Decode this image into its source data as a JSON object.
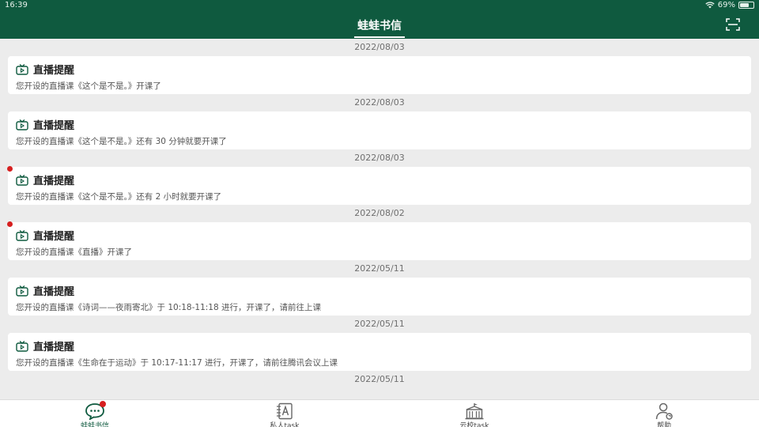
{
  "status_bar": {
    "time": "16:39",
    "battery": "69%",
    "battery_level": 0.69
  },
  "header": {
    "title": "蛙蛙书信",
    "scan_icon": "scan-icon"
  },
  "colors": {
    "primary": "#0f5a3f",
    "badge": "#d61f1f",
    "background": "#ececec"
  },
  "messages": [
    {
      "date": "2022/08/03",
      "title": "直播提醒",
      "body": "您开设的直播课《这个是不是。》开课了",
      "unread": false
    },
    {
      "date": "2022/08/03",
      "title": "直播提醒",
      "body": "您开设的直播课《这个是不是。》还有 30 分钟就要开课了",
      "unread": false
    },
    {
      "date": "2022/08/03",
      "title": "直播提醒",
      "body": "您开设的直播课《这个是不是。》还有 2 小时就要开课了",
      "unread": true
    },
    {
      "date": "2022/08/02",
      "title": "直播提醒",
      "body": "您开设的直播课《直播》开课了",
      "unread": true
    },
    {
      "date": "2022/05/11",
      "title": "直播提醒",
      "body": "您开设的直播课《诗词——夜雨寄北》于 10:18-11:18 进行，开课了，请前往上课",
      "unread": false
    },
    {
      "date": "2022/05/11",
      "title": "直播提醒",
      "body": "您开设的直播课《生命在于运动》于 10:17-11:17 进行，开课了，请前往腾讯会议上课",
      "unread": false
    },
    {
      "date": "2022/05/11"
    }
  ],
  "tabs": [
    {
      "label": "蛙蛙书信",
      "icon": "chat-bubble-icon",
      "active": true,
      "badge": true
    },
    {
      "label": "私人task",
      "icon": "notebook-a-icon",
      "active": false,
      "badge": false
    },
    {
      "label": "云校task",
      "icon": "school-building-icon",
      "active": false,
      "badge": false
    },
    {
      "label": "帮助",
      "icon": "user-help-icon",
      "active": false,
      "badge": false
    }
  ]
}
